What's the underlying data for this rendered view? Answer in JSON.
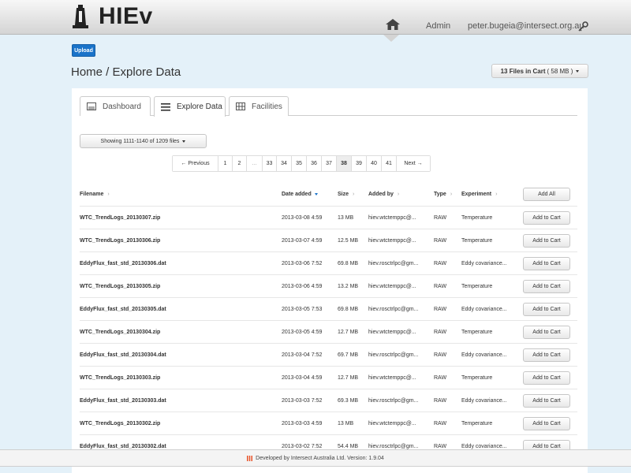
{
  "header": {
    "logo_text": "HIEv",
    "logo_icon": "tower-icon",
    "home_icon": "home-icon",
    "nav_admin": "Admin",
    "nav_user": "peter.bugeia@intersect.org.au",
    "user_icon": "key-icon"
  },
  "toolbar": {
    "upload_label": "Upload",
    "breadcrumb": "Home / Explore Data",
    "cart_count": "13 Files in Cart",
    "cart_size": "( 58 MB )"
  },
  "tabs": [
    {
      "label": "Dashboard",
      "icon": "dashboard-icon",
      "active": false
    },
    {
      "label": "Explore Data",
      "icon": "list-icon",
      "active": true
    },
    {
      "label": "Facilities",
      "icon": "building-icon",
      "active": false
    }
  ],
  "showing_label": "Showing 1111-1140 of 1209 files",
  "pagination": {
    "previous": "← Previous",
    "next": "Next →",
    "pages_left": [
      "1",
      "2"
    ],
    "ellipsis": "...",
    "pages_right": [
      "33",
      "34",
      "35",
      "36",
      "37",
      "38",
      "39",
      "40",
      "41"
    ],
    "active_page": "38"
  },
  "table": {
    "headers": {
      "filename": "Filename",
      "date": "Date added",
      "size": "Size",
      "added_by": "Added by",
      "type": "Type",
      "experiment": "Experiment",
      "add_all": "Add All"
    },
    "add_to_cart_label": "Add to Cart",
    "rows": [
      {
        "filename": "WTC_TrendLogs_20130307.zip",
        "date": "2013-03-08 4:59",
        "size": "13 MB",
        "added_by": "hiev.wtctemppc@...",
        "type": "RAW",
        "experiment": "Temperature"
      },
      {
        "filename": "WTC_TrendLogs_20130306.zip",
        "date": "2013-03-07 4:59",
        "size": "12.5 MB",
        "added_by": "hiev.wtctemppc@...",
        "type": "RAW",
        "experiment": "Temperature"
      },
      {
        "filename": "EddyFlux_fast_std_20130306.dat",
        "date": "2013-03-06 7:52",
        "size": "69.8 MB",
        "added_by": "hiev.rosctrlpc@gm...",
        "type": "RAW",
        "experiment": "Eddy covariance..."
      },
      {
        "filename": "WTC_TrendLogs_20130305.zip",
        "date": "2013-03-06 4:59",
        "size": "13.2 MB",
        "added_by": "hiev.wtctemppc@...",
        "type": "RAW",
        "experiment": "Temperature"
      },
      {
        "filename": "EddyFlux_fast_std_20130305.dat",
        "date": "2013-03-05 7:53",
        "size": "69.8 MB",
        "added_by": "hiev.rosctrlpc@gm...",
        "type": "RAW",
        "experiment": "Eddy covariance..."
      },
      {
        "filename": "WTC_TrendLogs_20130304.zip",
        "date": "2013-03-05 4:59",
        "size": "12.7 MB",
        "added_by": "hiev.wtctemppc@...",
        "type": "RAW",
        "experiment": "Temperature"
      },
      {
        "filename": "EddyFlux_fast_std_20130304.dat",
        "date": "2013-03-04 7:52",
        "size": "69.7 MB",
        "added_by": "hiev.rosctrlpc@gm...",
        "type": "RAW",
        "experiment": "Eddy covariance..."
      },
      {
        "filename": "WTC_TrendLogs_20130303.zip",
        "date": "2013-03-04 4:59",
        "size": "12.7 MB",
        "added_by": "hiev.wtctemppc@...",
        "type": "RAW",
        "experiment": "Temperature"
      },
      {
        "filename": "EddyFlux_fast_std_20130303.dat",
        "date": "2013-03-03 7:52",
        "size": "69.3 MB",
        "added_by": "hiev.rosctrlpc@gm...",
        "type": "RAW",
        "experiment": "Eddy covariance..."
      },
      {
        "filename": "WTC_TrendLogs_20130302.zip",
        "date": "2013-03-03 4:59",
        "size": "13 MB",
        "added_by": "hiev.wtctemppc@...",
        "type": "RAW",
        "experiment": "Temperature"
      },
      {
        "filename": "EddyFlux_fast_std_20130302.dat",
        "date": "2013-03-02 7:52",
        "size": "54.4 MB",
        "added_by": "hiev.rosctrlpc@gm...",
        "type": "RAW",
        "experiment": "Eddy covariance..."
      }
    ]
  },
  "footer": {
    "text": "Developed by Intersect Australia Ltd. Version: 1.9.04",
    "logo": "intersect-logo-icon"
  },
  "colors": {
    "background": "#e4f1f9",
    "primary": "#1a73c9",
    "footer_logo": "#e8542a"
  }
}
